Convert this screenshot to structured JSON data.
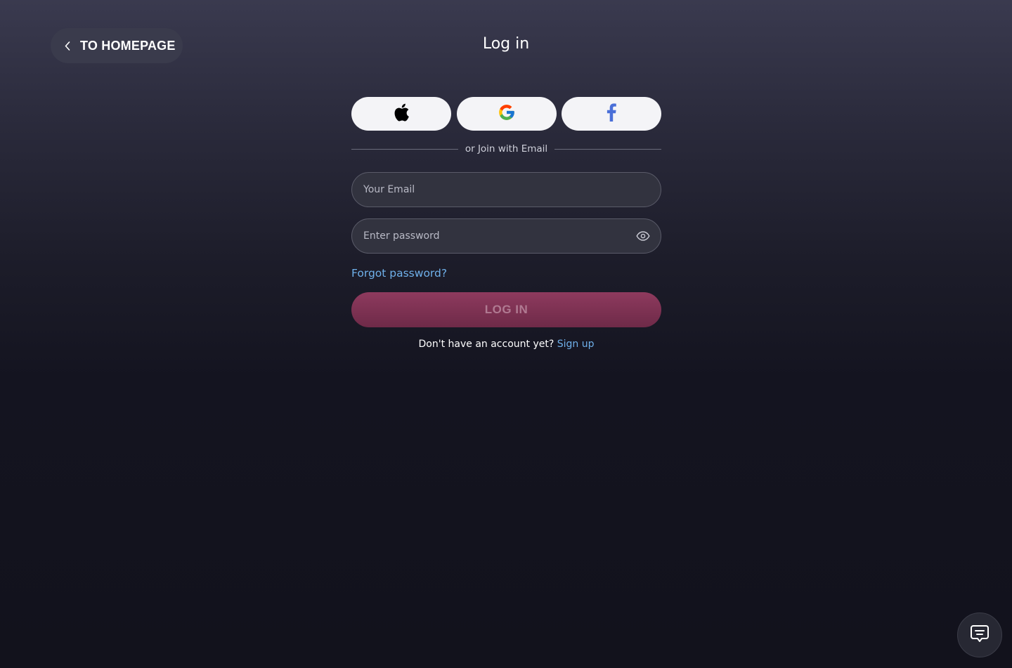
{
  "header": {
    "back_label": "TO HOMEPAGE",
    "title": "Log in"
  },
  "social": {
    "apple": "apple-icon",
    "google": "google-icon",
    "facebook": "facebook-icon"
  },
  "divider_text": "or Join with Email",
  "fields": {
    "email_placeholder": "Your Email",
    "password_placeholder": "Enter password"
  },
  "forgot_label": "Forgot password?",
  "login_label": "LOG IN",
  "signup": {
    "prompt": "Don't have an account yet?",
    "link": "Sign up"
  },
  "colors": {
    "accent_link": "#6fb0ea",
    "login_button": "#8e3a5e",
    "facebook_blue": "#4a6fd8"
  }
}
